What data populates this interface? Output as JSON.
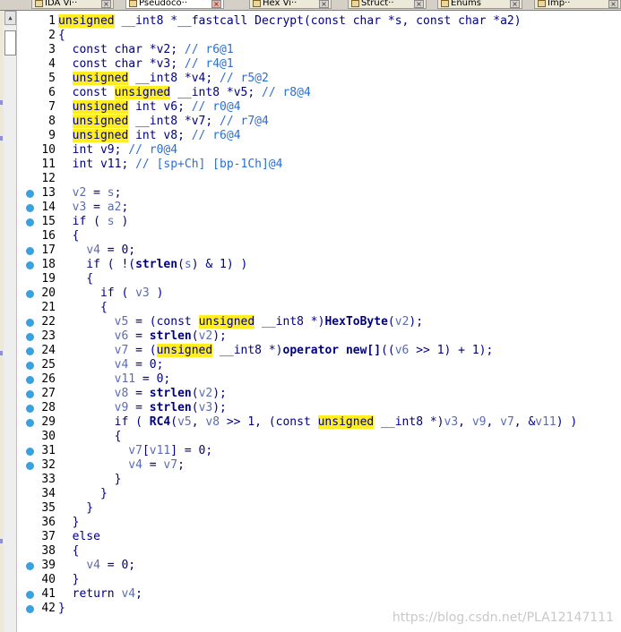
{
  "tabs": [
    {
      "label": "IDA Vi··",
      "icon": "ida-view-icon",
      "active": false
    },
    {
      "label": "Pseudoco··",
      "icon": "pseudocode-icon",
      "active": true
    },
    {
      "label": "Hex Vi··",
      "icon": "hex-view-icon",
      "active": false
    },
    {
      "label": "Struct··",
      "icon": "structures-icon",
      "active": false
    },
    {
      "label": "Enums",
      "icon": "enums-icon",
      "active": false
    },
    {
      "label": "Imp··",
      "icon": "imports-icon",
      "active": false
    }
  ],
  "close_glyph": "×",
  "code_lines": [
    {
      "n": "1",
      "bp": false,
      "parts": [
        {
          "t": "unsigned",
          "c": "hl"
        },
        {
          "t": " __int8 *__fastcall Decrypt(const char *s, const char *a2)"
        }
      ]
    },
    {
      "n": "2",
      "bp": false,
      "parts": [
        {
          "t": "{"
        }
      ]
    },
    {
      "n": "3",
      "bp": false,
      "parts": [
        {
          "t": "  const char *v2; "
        },
        {
          "t": "// r6@1",
          "c": "cm"
        }
      ]
    },
    {
      "n": "4",
      "bp": false,
      "parts": [
        {
          "t": "  const char *v3; "
        },
        {
          "t": "// r4@1",
          "c": "cm"
        }
      ]
    },
    {
      "n": "5",
      "bp": false,
      "parts": [
        {
          "t": "  "
        },
        {
          "t": "unsigned",
          "c": "hl"
        },
        {
          "t": " __int8 *v4; "
        },
        {
          "t": "// r5@2",
          "c": "cm"
        }
      ]
    },
    {
      "n": "6",
      "bp": false,
      "parts": [
        {
          "t": "  const "
        },
        {
          "t": "unsigned",
          "c": "hl"
        },
        {
          "t": " __int8 *v5; "
        },
        {
          "t": "// r8@4",
          "c": "cm"
        }
      ]
    },
    {
      "n": "7",
      "bp": false,
      "parts": [
        {
          "t": "  "
        },
        {
          "t": "unsigned",
          "c": "hl"
        },
        {
          "t": " int v6; "
        },
        {
          "t": "// r0@4",
          "c": "cm"
        }
      ]
    },
    {
      "n": "8",
      "bp": false,
      "parts": [
        {
          "t": "  "
        },
        {
          "t": "unsigned",
          "c": "hl"
        },
        {
          "t": " __int8 *v7; "
        },
        {
          "t": "// r7@4",
          "c": "cm"
        }
      ]
    },
    {
      "n": "9",
      "bp": false,
      "parts": [
        {
          "t": "  "
        },
        {
          "t": "unsigned",
          "c": "hl"
        },
        {
          "t": " int v8; "
        },
        {
          "t": "// r6@4",
          "c": "cm"
        }
      ]
    },
    {
      "n": "10",
      "bp": false,
      "parts": [
        {
          "t": "  int v9; "
        },
        {
          "t": "// r0@4",
          "c": "cm"
        }
      ]
    },
    {
      "n": "11",
      "bp": false,
      "parts": [
        {
          "t": "  int v11; "
        },
        {
          "t": "// [sp+Ch] [bp-1Ch]@4",
          "c": "cm"
        }
      ]
    },
    {
      "n": "12",
      "bp": false,
      "parts": [
        {
          "t": ""
        }
      ]
    },
    {
      "n": "13",
      "bp": true,
      "parts": [
        {
          "t": "  "
        },
        {
          "t": "v2",
          "c": "var"
        },
        {
          "t": " = "
        },
        {
          "t": "s",
          "c": "var"
        },
        {
          "t": ";"
        }
      ]
    },
    {
      "n": "14",
      "bp": true,
      "parts": [
        {
          "t": "  "
        },
        {
          "t": "v3",
          "c": "var"
        },
        {
          "t": " = "
        },
        {
          "t": "a2",
          "c": "var"
        },
        {
          "t": ";"
        }
      ]
    },
    {
      "n": "15",
      "bp": true,
      "parts": [
        {
          "t": "  if ( "
        },
        {
          "t": "s",
          "c": "var"
        },
        {
          "t": " )"
        }
      ]
    },
    {
      "n": "16",
      "bp": false,
      "parts": [
        {
          "t": "  {"
        }
      ]
    },
    {
      "n": "17",
      "bp": true,
      "parts": [
        {
          "t": "    "
        },
        {
          "t": "v4",
          "c": "var"
        },
        {
          "t": " = 0;"
        }
      ]
    },
    {
      "n": "18",
      "bp": true,
      "parts": [
        {
          "t": "    if ( !("
        },
        {
          "t": "strlen",
          "c": "fn"
        },
        {
          "t": "("
        },
        {
          "t": "s",
          "c": "var"
        },
        {
          "t": ") & 1) )"
        }
      ]
    },
    {
      "n": "19",
      "bp": false,
      "parts": [
        {
          "t": "    {"
        }
      ]
    },
    {
      "n": "20",
      "bp": true,
      "parts": [
        {
          "t": "      if ( "
        },
        {
          "t": "v3",
          "c": "var"
        },
        {
          "t": " )"
        }
      ]
    },
    {
      "n": "21",
      "bp": false,
      "parts": [
        {
          "t": "      {"
        }
      ]
    },
    {
      "n": "22",
      "bp": true,
      "parts": [
        {
          "t": "        "
        },
        {
          "t": "v5",
          "c": "var"
        },
        {
          "t": " = (const "
        },
        {
          "t": "unsigned",
          "c": "hl"
        },
        {
          "t": " __int8 *)"
        },
        {
          "t": "HexToByte",
          "c": "fn"
        },
        {
          "t": "("
        },
        {
          "t": "v2",
          "c": "var"
        },
        {
          "t": ");"
        }
      ]
    },
    {
      "n": "23",
      "bp": true,
      "parts": [
        {
          "t": "        "
        },
        {
          "t": "v6",
          "c": "var"
        },
        {
          "t": " = "
        },
        {
          "t": "strlen",
          "c": "fn"
        },
        {
          "t": "("
        },
        {
          "t": "v2",
          "c": "var"
        },
        {
          "t": ");"
        }
      ]
    },
    {
      "n": "24",
      "bp": true,
      "parts": [
        {
          "t": "        "
        },
        {
          "t": "v7",
          "c": "var"
        },
        {
          "t": " = ("
        },
        {
          "t": "unsigned",
          "c": "hl"
        },
        {
          "t": " __int8 *)"
        },
        {
          "t": "operator new[]",
          "c": "fn"
        },
        {
          "t": "(("
        },
        {
          "t": "v6",
          "c": "var"
        },
        {
          "t": " >> 1) + 1);"
        }
      ]
    },
    {
      "n": "25",
      "bp": true,
      "parts": [
        {
          "t": "        "
        },
        {
          "t": "v4",
          "c": "var"
        },
        {
          "t": " = 0;"
        }
      ]
    },
    {
      "n": "26",
      "bp": true,
      "parts": [
        {
          "t": "        "
        },
        {
          "t": "v11",
          "c": "var"
        },
        {
          "t": " = 0;"
        }
      ]
    },
    {
      "n": "27",
      "bp": true,
      "parts": [
        {
          "t": "        "
        },
        {
          "t": "v8",
          "c": "var"
        },
        {
          "t": " = "
        },
        {
          "t": "strlen",
          "c": "fn"
        },
        {
          "t": "("
        },
        {
          "t": "v2",
          "c": "var"
        },
        {
          "t": ");"
        }
      ]
    },
    {
      "n": "28",
      "bp": true,
      "parts": [
        {
          "t": "        "
        },
        {
          "t": "v9",
          "c": "var"
        },
        {
          "t": " = "
        },
        {
          "t": "strlen",
          "c": "fn"
        },
        {
          "t": "("
        },
        {
          "t": "v3",
          "c": "var"
        },
        {
          "t": ");"
        }
      ]
    },
    {
      "n": "29",
      "bp": true,
      "parts": [
        {
          "t": "        if ( "
        },
        {
          "t": "RC4",
          "c": "fn"
        },
        {
          "t": "("
        },
        {
          "t": "v5",
          "c": "var"
        },
        {
          "t": ", "
        },
        {
          "t": "v8",
          "c": "var"
        },
        {
          "t": " >> 1, (const "
        },
        {
          "t": "unsigned",
          "c": "hl"
        },
        {
          "t": " __int8 *)"
        },
        {
          "t": "v3",
          "c": "var"
        },
        {
          "t": ", "
        },
        {
          "t": "v9",
          "c": "var"
        },
        {
          "t": ", "
        },
        {
          "t": "v7",
          "c": "var"
        },
        {
          "t": ", &"
        },
        {
          "t": "v11",
          "c": "var"
        },
        {
          "t": ") )"
        }
      ]
    },
    {
      "n": "30",
      "bp": false,
      "parts": [
        {
          "t": "        {"
        }
      ]
    },
    {
      "n": "31",
      "bp": true,
      "parts": [
        {
          "t": "          "
        },
        {
          "t": "v7",
          "c": "var"
        },
        {
          "t": "["
        },
        {
          "t": "v11",
          "c": "var"
        },
        {
          "t": "] = 0;"
        }
      ]
    },
    {
      "n": "32",
      "bp": true,
      "parts": [
        {
          "t": "          "
        },
        {
          "t": "v4",
          "c": "var"
        },
        {
          "t": " = "
        },
        {
          "t": "v7",
          "c": "var"
        },
        {
          "t": ";"
        }
      ]
    },
    {
      "n": "33",
      "bp": false,
      "parts": [
        {
          "t": "        }"
        }
      ]
    },
    {
      "n": "34",
      "bp": false,
      "parts": [
        {
          "t": "      }"
        }
      ]
    },
    {
      "n": "35",
      "bp": false,
      "parts": [
        {
          "t": "    }"
        }
      ]
    },
    {
      "n": "36",
      "bp": false,
      "parts": [
        {
          "t": "  }"
        }
      ]
    },
    {
      "n": "37",
      "bp": false,
      "parts": [
        {
          "t": "  else"
        }
      ]
    },
    {
      "n": "38",
      "bp": false,
      "parts": [
        {
          "t": "  {"
        }
      ]
    },
    {
      "n": "39",
      "bp": true,
      "parts": [
        {
          "t": "    "
        },
        {
          "t": "v4",
          "c": "var"
        },
        {
          "t": " = 0;"
        }
      ]
    },
    {
      "n": "40",
      "bp": false,
      "parts": [
        {
          "t": "  }"
        }
      ]
    },
    {
      "n": "41",
      "bp": true,
      "parts": [
        {
          "t": "  return "
        },
        {
          "t": "v4",
          "c": "var"
        },
        {
          "t": ";"
        }
      ]
    },
    {
      "n": "42",
      "bp": true,
      "parts": [
        {
          "t": "}"
        }
      ]
    }
  ],
  "watermark": "https://blog.csdn.net/PLA12147111",
  "colors": {
    "highlight": "#ffee20",
    "code_text": "#000080",
    "comment": "#2b6fd0",
    "breakpoint_dot": "#3aa0e0",
    "line_number": "#000000"
  }
}
